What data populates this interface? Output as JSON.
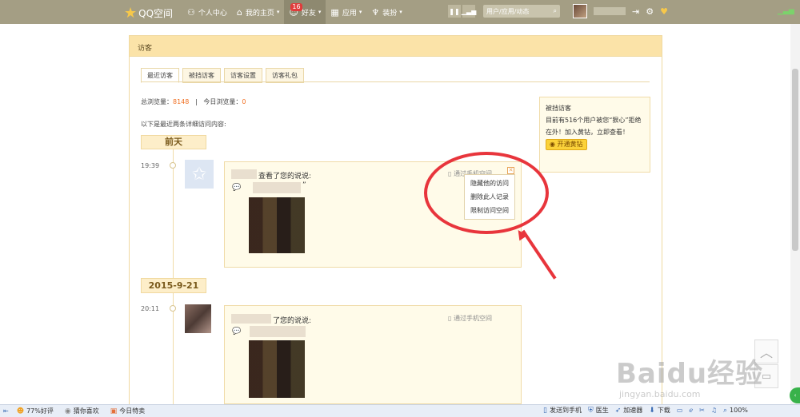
{
  "topbar": {
    "logo": "QQ空间",
    "nav": [
      {
        "label": "个人中心",
        "icon": "person-icon"
      },
      {
        "label": "我的主页",
        "icon": "home-icon",
        "arrow": "▾"
      },
      {
        "label": "好友",
        "icon": "friends-icon",
        "arrow": "▾",
        "badge": "16"
      },
      {
        "label": "应用",
        "icon": "apps-icon",
        "arrow": "▾"
      },
      {
        "label": "装扮",
        "icon": "shirt-icon",
        "arrow": "▾"
      }
    ],
    "search_placeholder": "用户/应用/动态"
  },
  "visitors": {
    "title": "访客",
    "tabs": [
      "最近访客",
      "被挡访客",
      "访客设置",
      "访客礼包"
    ],
    "total_label": "总浏览量：",
    "total_value": "8148",
    "separator": "|",
    "today_label": "今日浏览量：",
    "today_value": "0",
    "intro": "以下是最近两条详细访问内容:",
    "entries": [
      {
        "date": "前天",
        "time": "19:39",
        "action": "查看了您的说说:",
        "quote": "”",
        "source": "通过手机空间"
      },
      {
        "date": "2015-9-21",
        "time": "20:11",
        "action": "了您的说说:",
        "source": "通过手机空间"
      }
    ],
    "menu": [
      "隐藏他的访问",
      "删除此人记录",
      "限制访问空间"
    ],
    "close_glyph": "✕"
  },
  "sidebox": {
    "title": "被挡访客",
    "text": "目前有516个用户被您“狠心”拒绝在外！加入黄钻，立即查看！",
    "button": "开通黄钻"
  },
  "watermark": {
    "main": "Baidu经验",
    "sub": "jingyan.baidu.com"
  },
  "statusbar": {
    "items_left": [
      "77%好评",
      "猜你喜欢",
      "今日特卖"
    ],
    "items_right": [
      "发送到手机",
      "医生",
      "加速器",
      "下载",
      "100%"
    ]
  },
  "colors": {
    "accent": "#f07023",
    "topbar": "#a49e84",
    "annotation": "#e8353c"
  }
}
